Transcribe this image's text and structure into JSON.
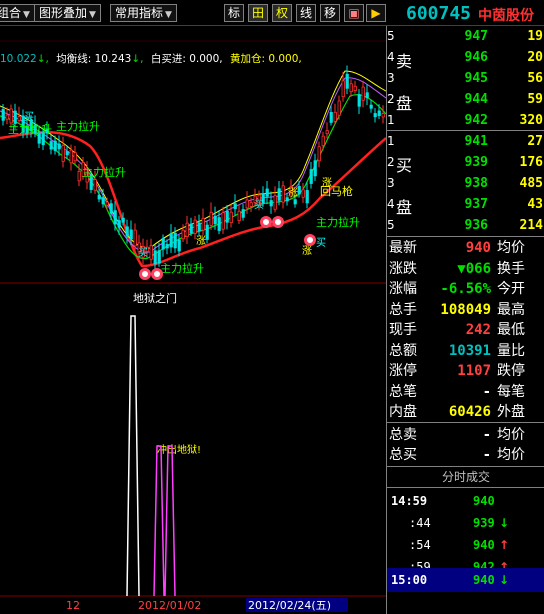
{
  "toolbar": {
    "buttons": [
      {
        "label": "组合"
      },
      {
        "label": "图形叠加"
      },
      {
        "label": "常用指标"
      }
    ],
    "icons": [
      {
        "label": "标",
        "name": "mark-icon"
      },
      {
        "label": "田",
        "name": "grid-icon"
      },
      {
        "label": "权",
        "name": "rights-icon"
      },
      {
        "label": "线",
        "name": "line-icon"
      },
      {
        "label": "移",
        "name": "move-icon"
      }
    ],
    "stock_code": "600745",
    "stock_name": "中茵股份"
  },
  "ma_legend": {
    "v1": "10.022",
    "balance_label": "均衡线: 10.243",
    "white_buy": "白买进: 0.000,",
    "yellow_add": "黄加仓: 0.000,"
  },
  "chart_annotations": {
    "labels": [
      "主力拉升",
      "主力拉升",
      "主力拉升",
      "主力拉升",
      "主力拉升",
      "回马枪",
      "涨",
      "涨",
      "涨",
      "涨",
      "买",
      "买",
      "买",
      "买"
    ],
    "lower_title": "地狱之门",
    "lower_second": "冲出地狱!"
  },
  "time_axis": {
    "t1": "12",
    "t2": "2012/01/02",
    "t3": "2012/02/24(五)"
  },
  "orderbook": {
    "sell_label_1": "卖",
    "sell_label_2": "盘",
    "buy_label_1": "买",
    "buy_label_2": "盘",
    "asks": [
      {
        "n": "5",
        "price": "947",
        "vol": "19"
      },
      {
        "n": "4",
        "price": "946",
        "vol": "20"
      },
      {
        "n": "3",
        "price": "945",
        "vol": "56"
      },
      {
        "n": "2",
        "price": "944",
        "vol": "59"
      },
      {
        "n": "1",
        "price": "942",
        "vol": "320"
      }
    ],
    "bids": [
      {
        "n": "1",
        "price": "941",
        "vol": "27"
      },
      {
        "n": "2",
        "price": "939",
        "vol": "176"
      },
      {
        "n": "3",
        "price": "938",
        "vol": "485"
      },
      {
        "n": "4",
        "price": "937",
        "vol": "43"
      },
      {
        "n": "5",
        "price": "936",
        "vol": "214"
      }
    ]
  },
  "quote": {
    "rows": [
      {
        "l1": "最新",
        "v": "940",
        "color": "red",
        "l2": "均价"
      },
      {
        "l1": "涨跌",
        "v": "▼066",
        "color": "green",
        "l2": "换手"
      },
      {
        "l1": "涨幅",
        "v": "-6.56%",
        "color": "green",
        "l2": "今开"
      },
      {
        "l1": "总手",
        "v": "108049",
        "color": "yellow",
        "l2": "最高"
      },
      {
        "l1": "现手",
        "v": "242",
        "color": "red",
        "l2": "最低"
      },
      {
        "l1": "总额",
        "v": "10391",
        "color": "cyan",
        "l2": "量比"
      },
      {
        "l1": "涨停",
        "v": "1107",
        "color": "red",
        "l2": "跌停"
      },
      {
        "l1": "总笔",
        "v": "-",
        "color": "white",
        "l2": "每笔"
      },
      {
        "l1": "内盘",
        "v": "60426",
        "color": "yellow",
        "l2": "外盘"
      }
    ],
    "total_sell": {
      "l1": "总卖",
      "v": "-",
      "l2": "均价"
    },
    "total_buy": {
      "l1": "总买",
      "v": "-",
      "l2": "均价"
    }
  },
  "transactions": {
    "title": "分时成交",
    "rows": [
      {
        "time": "14:59",
        "price": "940",
        "color": "green",
        "dir": ""
      },
      {
        "time": ":44",
        "price": "939",
        "color": "green",
        "dir": "↓"
      },
      {
        "time": ":54",
        "price": "940",
        "color": "green",
        "dir": "↑"
      },
      {
        "time": ":59",
        "price": "942",
        "color": "green",
        "dir": "↑"
      },
      {
        "time": "15:00",
        "price": "940",
        "color": "green",
        "dir": "↓"
      }
    ]
  }
}
